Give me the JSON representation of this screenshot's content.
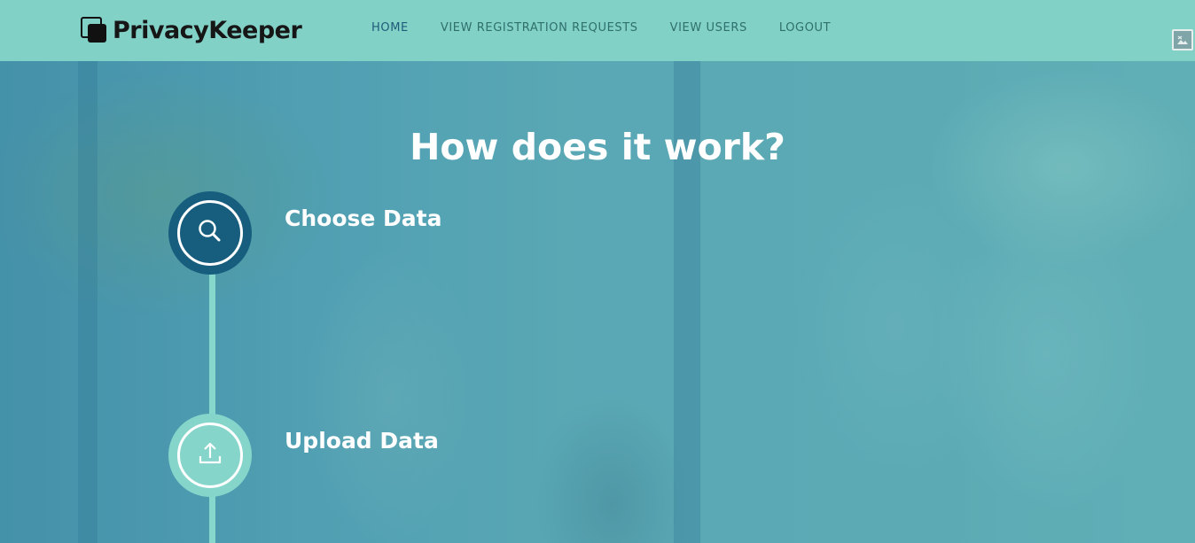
{
  "brand": {
    "name": "PrivacyKeeper",
    "icon": "overlapping-squares-logo"
  },
  "nav": {
    "items": [
      {
        "label": "HOME",
        "active": true
      },
      {
        "label": "VIEW REGISTRATION REQUESTS",
        "active": false
      },
      {
        "label": "VIEW USERS",
        "active": false
      },
      {
        "label": "LOGOUT",
        "active": false
      }
    ]
  },
  "broken_image": {
    "icon": "broken-image-icon"
  },
  "section": {
    "title": "How does it work?",
    "steps": [
      {
        "label": "Choose Data",
        "icon": "search-icon"
      },
      {
        "label": "Upload Data",
        "icon": "upload-icon"
      }
    ]
  },
  "colors": {
    "navbar_bg": "#82d1c7",
    "step_dark": "#175e7e",
    "step_light": "#86d5cb",
    "timeline": "#86d8cc",
    "nav_active": "#1f5a78",
    "nav_text": "#2f6f6c"
  }
}
